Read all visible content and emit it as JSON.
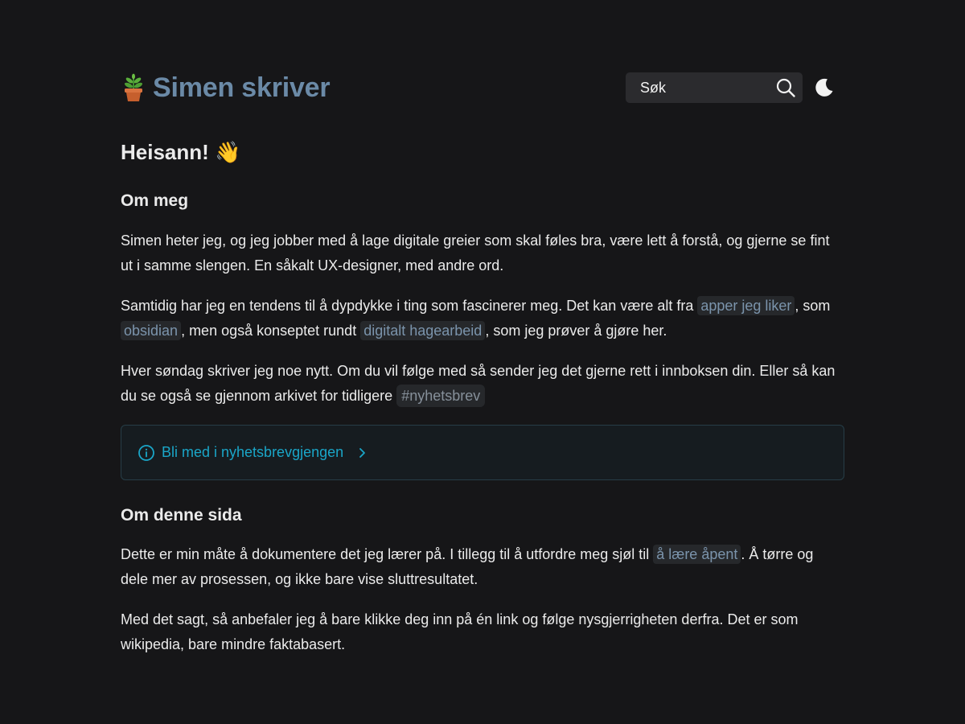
{
  "header": {
    "site_title": "Simen skriver",
    "logo_icon": "potted-plant-icon",
    "search": {
      "label": "Søk",
      "icon": "search-icon"
    },
    "theme_toggle_icon": "moon-icon"
  },
  "main": {
    "greeting": "Heisann!",
    "greeting_emoji": "👋",
    "about": {
      "heading": "Om meg",
      "p1": "Simen heter jeg, og jeg jobber med å lage digitale greier som skal føles bra, være lett å forstå, og gjerne se fint ut i samme slengen. En såkalt UX-designer, med andre ord.",
      "p2": {
        "t1": "Samtidig har jeg en tendens til å dypdykke i ting som fascinerer meg. Det kan være alt fra ",
        "link1": "apper jeg liker",
        "t2": ", som ",
        "link2": "obsidian",
        "t3": ", men også konseptet rundt ",
        "link3": "digitalt hagearbeid",
        "t4": ", som jeg prøver å gjøre her."
      },
      "p3": {
        "t1": "Hver søndag skriver jeg noe nytt. Om du vil følge med så sender jeg det gjerne rett i innboksen din. Eller så kan du se også se gjennom arkivet for tidligere ",
        "tag": "#nyhetsbrev"
      },
      "callout": {
        "label": "Bli med i nyhetsbrevgjengen",
        "icon": "info-icon",
        "chevron_icon": "chevron-right-icon",
        "accent_color": "#1aa6c8"
      }
    },
    "site": {
      "heading": "Om denne sida",
      "p1": {
        "t1": "Dette er min måte å dokumentere det jeg lærer på. I tillegg til å utfordre meg sjøl til ",
        "link": "å lære åpent",
        "t2": ". Å tørre og dele mer av prosessen, og ikke bare vise sluttresultatet."
      },
      "p2": "Med det sagt, så anbefaler jeg å bare klikke deg inn på én link og følge nysgjerrigheten derfra. Det er som wikipedia, bare mindre faktabasert."
    }
  },
  "colors": {
    "background": "#161618",
    "brand": "#6b8aa7",
    "link": "#7b94ac",
    "link_bg": "#26282b",
    "text": "#ebebeb"
  }
}
